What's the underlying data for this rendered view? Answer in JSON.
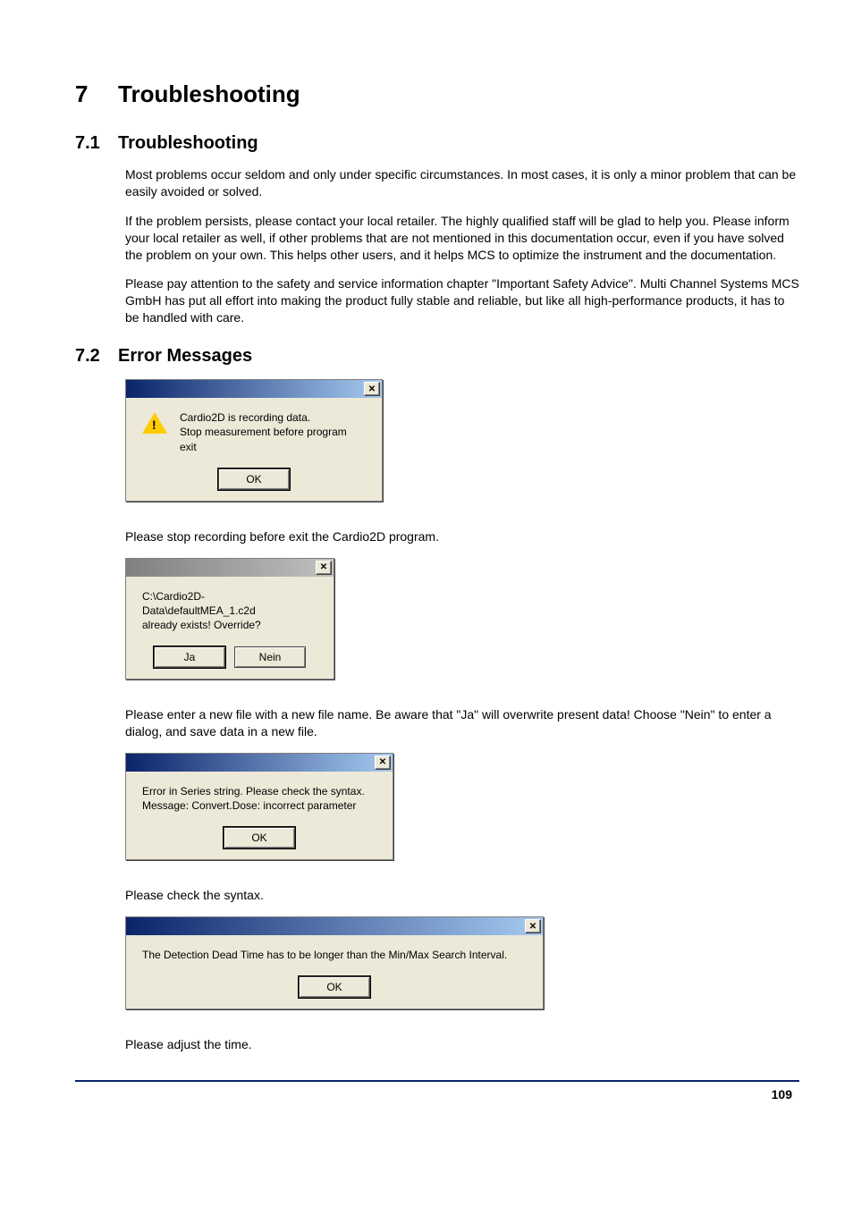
{
  "chapter": {
    "num": "7",
    "title": "Troubleshooting"
  },
  "sections": {
    "s1": {
      "num": "7.1",
      "title": "Troubleshooting"
    },
    "s2": {
      "num": "7.2",
      "title": "Error Messages"
    }
  },
  "paras": {
    "p1": "Most problems occur seldom and only under specific circumstances. In most cases, it is only a minor problem that can be easily avoided or solved.",
    "p2": "If the problem persists, please contact your local retailer. The highly qualified staff will be glad to help you. Please inform your local retailer as well, if other problems that are not mentioned in this documentation occur, even if you have solved the problem on your own. This helps other users, and it helps MCS to optimize the instrument and the documentation.",
    "p3": "Please pay attention to the safety and service information chapter \"Important Safety Advice\". Multi Channel Systems MCS GmbH has put all effort into making the product fully stable and reliable, but like all high-performance products, it has to be handled with care.",
    "d1after": "Please stop recording before exit the Cardio2D program.",
    "d2after": "Please enter a new file with a new file name. Be aware that \"Ja\" will overwrite present data! Choose \"Nein\" to enter a dialog, and save data in a new file.",
    "d3after": "Please check the syntax.",
    "d4after": "Please adjust the time."
  },
  "dialogs": {
    "d1": {
      "msg_l1": "Cardio2D is recording data.",
      "msg_l2": "Stop measurement before program exit",
      "ok": "OK"
    },
    "d2": {
      "msg_l1": "C:\\Cardio2D-Data\\defaultMEA_1.c2d",
      "msg_l2": "already exists! Override?",
      "ja": "Ja",
      "nein": "Nein"
    },
    "d3": {
      "msg_l1": "Error in Series string. Please check the syntax.",
      "msg_l2": "Message: Convert.Dose: incorrect parameter",
      "ok": "OK"
    },
    "d4": {
      "msg": "The Detection Dead Time has to be longer than the Min/Max Search Interval.",
      "ok": "OK"
    }
  },
  "close_glyph": "✕",
  "page_number": "109"
}
